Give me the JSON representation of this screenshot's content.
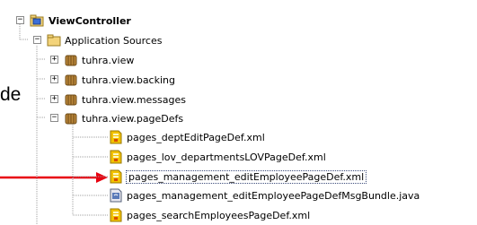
{
  "callout": {
    "text": "de"
  },
  "tree": {
    "root": {
      "label": "ViewController",
      "icon": "project-folder-icon",
      "toggle": "−"
    },
    "app_sources": {
      "label": "Application Sources",
      "icon": "folder-icon",
      "toggle": "−"
    },
    "packages": [
      {
        "label": "tuhra.view",
        "icon": "package-icon",
        "toggle": "+"
      },
      {
        "label": "tuhra.view.backing",
        "icon": "package-icon",
        "toggle": "+"
      },
      {
        "label": "tuhra.view.messages",
        "icon": "package-icon",
        "toggle": "+"
      },
      {
        "label": "tuhra.view.pageDefs",
        "icon": "package-icon",
        "toggle": "−"
      }
    ],
    "files": [
      {
        "label": "pages_deptEditPageDef.xml",
        "icon": "xml-file-icon"
      },
      {
        "label": "pages_lov_departmentsLOVPageDef.xml",
        "icon": "xml-file-icon"
      },
      {
        "label": "pages_management_editEmployeePageDef.xml",
        "icon": "xml-file-icon"
      },
      {
        "label": "pages_management_editEmployeePageDefMsgBundle.java",
        "icon": "java-file-icon"
      },
      {
        "label": "pages_searchEmployeesPageDef.xml",
        "icon": "xml-file-icon"
      }
    ]
  },
  "colors": {
    "arrow": "#e8000f",
    "tree_lines": "#a0a0a0",
    "folder": "#f3d37a",
    "package": "#b9863a",
    "xml": "#f2c200"
  }
}
